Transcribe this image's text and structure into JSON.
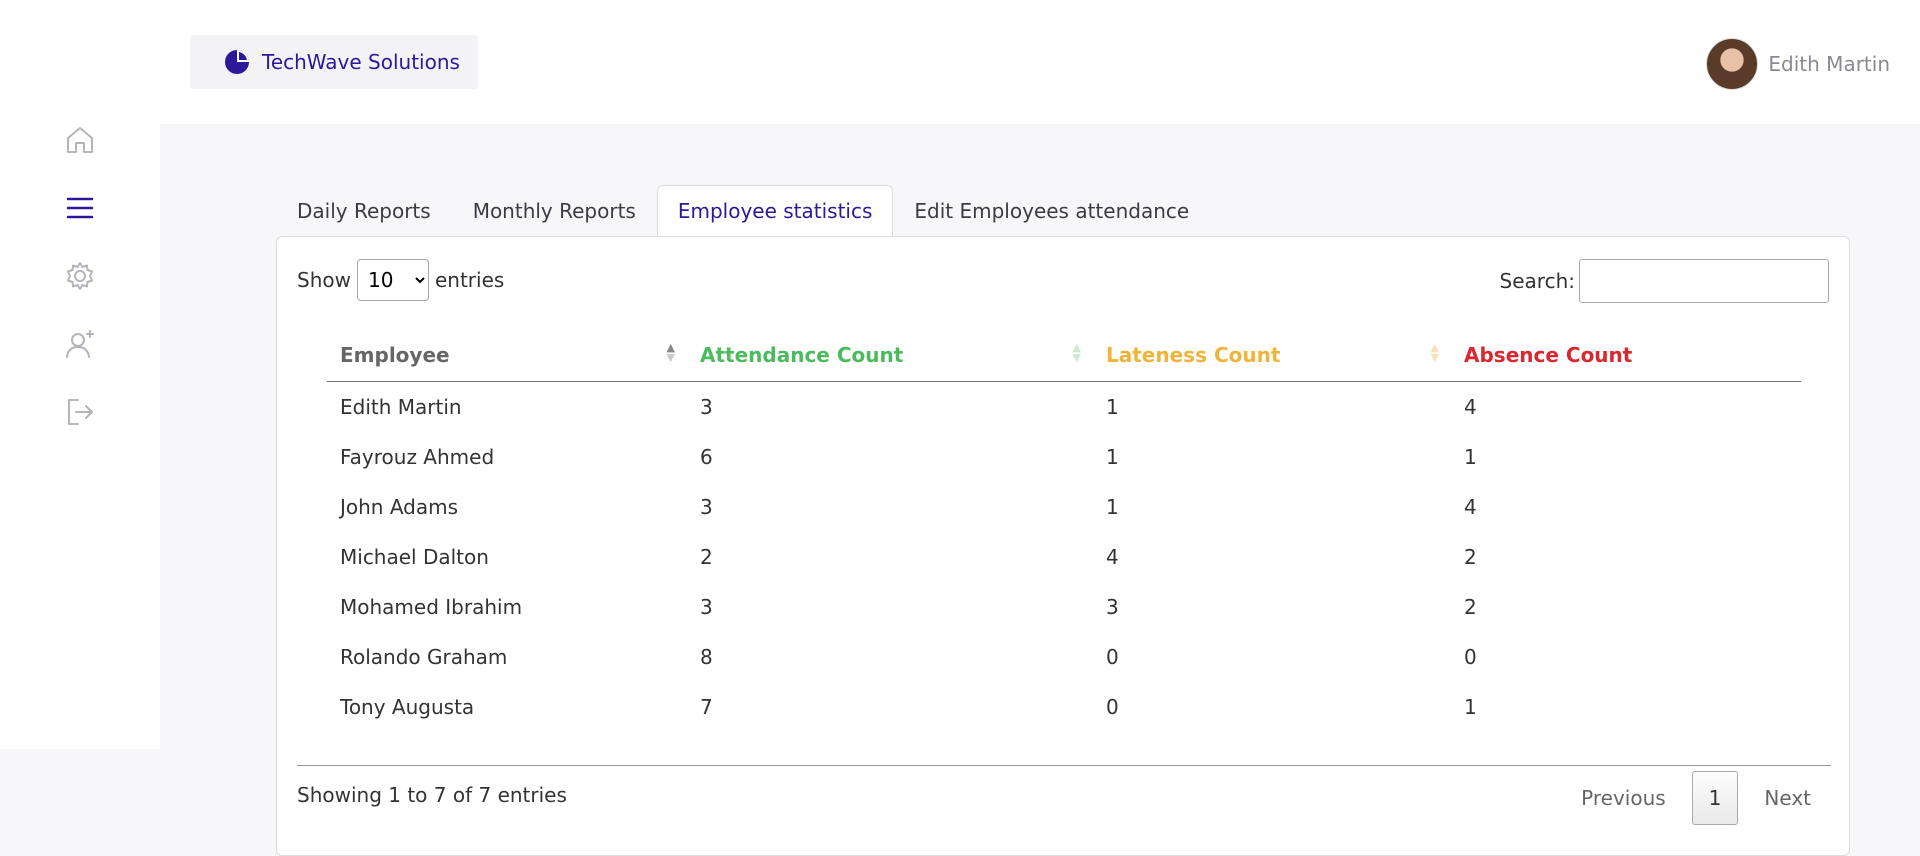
{
  "brand": {
    "name": "TechWave Solutions"
  },
  "user": {
    "name": "Edith Martin"
  },
  "sidebar": {
    "icons": [
      "home-icon",
      "menu-icon",
      "gear-icon",
      "add-user-icon",
      "logout-icon"
    ]
  },
  "tabs": [
    {
      "label": "Daily Reports"
    },
    {
      "label": "Monthly Reports"
    },
    {
      "label": "Employee statistics",
      "active": true
    },
    {
      "label": "Edit Employees attendance"
    }
  ],
  "table_controls": {
    "show_label": "Show",
    "entries_label": "entries",
    "page_size": "10",
    "search_label": "Search:"
  },
  "table": {
    "headers": [
      "Employee",
      "Attendance Count",
      "Lateness Count",
      "Absence Count"
    ],
    "rows": [
      [
        "Edith Martin",
        "3",
        "1",
        "4"
      ],
      [
        "Fayrouz Ahmed",
        "6",
        "1",
        "1"
      ],
      [
        "John Adams",
        "3",
        "1",
        "4"
      ],
      [
        "Michael Dalton",
        "2",
        "4",
        "2"
      ],
      [
        "Mohamed Ibrahim",
        "3",
        "3",
        "2"
      ],
      [
        "Rolando Graham",
        "8",
        "0",
        "0"
      ],
      [
        "Tony Augusta",
        "7",
        "0",
        "1"
      ]
    ]
  },
  "footer": {
    "info": "Showing 1 to 7 of 7 entries",
    "previous": "Previous",
    "page": "1",
    "next": "Next"
  },
  "colors": {
    "accent": "#2a1a9a",
    "attendance": "#4cbb5e",
    "lateness": "#f0b43a",
    "absence": "#d9282f"
  }
}
